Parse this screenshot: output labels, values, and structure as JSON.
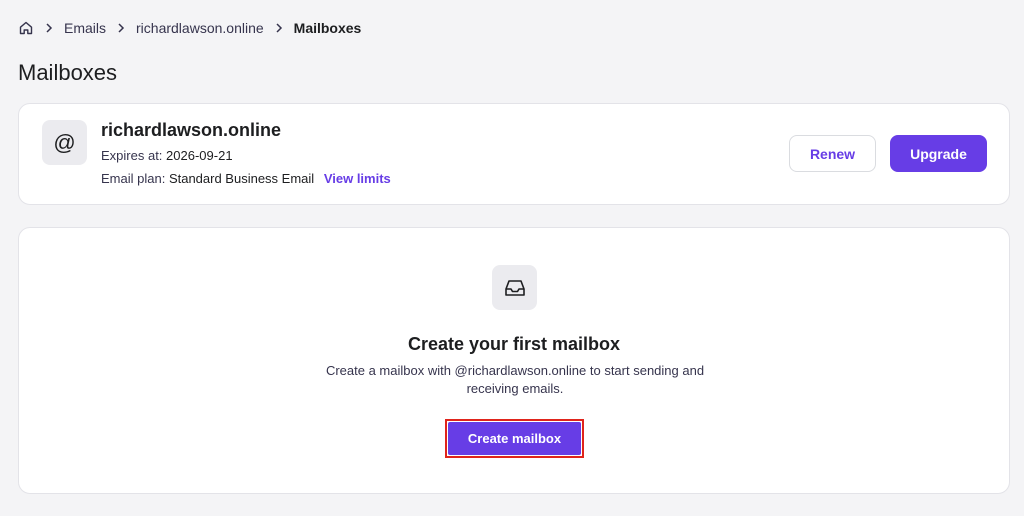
{
  "breadcrumb": {
    "home_icon": "home-icon",
    "items": [
      "Emails",
      "richardlawson.online"
    ],
    "current": "Mailboxes"
  },
  "page": {
    "title": "Mailboxes"
  },
  "domain_card": {
    "avatar_symbol": "@",
    "name": "richardlawson.online",
    "expires_label": "Expires at:",
    "expires_value": "2026-09-21",
    "plan_label": "Email plan:",
    "plan_value": "Standard Business Email",
    "view_limits": "View limits",
    "renew_label": "Renew",
    "upgrade_label": "Upgrade"
  },
  "empty_state": {
    "icon": "inbox-icon",
    "title": "Create your first mailbox",
    "description": "Create a mailbox with @richardlawson.online to start sending and receiving emails.",
    "create_label": "Create mailbox"
  },
  "colors": {
    "accent": "#673de6",
    "highlight": "#e0241b",
    "background": "#f4f4f6"
  }
}
